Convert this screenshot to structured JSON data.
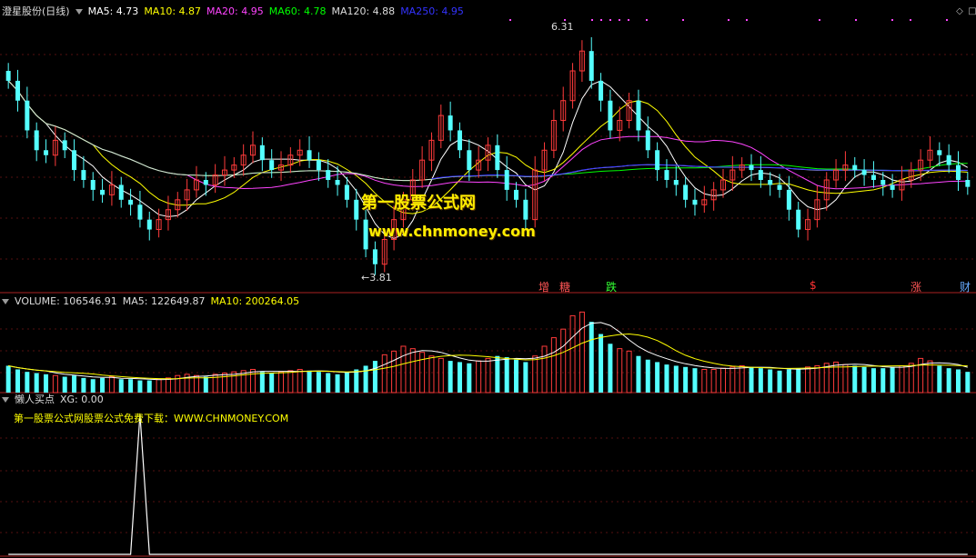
{
  "price_header": {
    "name": "澄星股份(日线)",
    "ma": [
      {
        "label": "MA5: 4.73",
        "color": "#ffffff"
      },
      {
        "label": "MA10: 4.87",
        "color": "#ffff00"
      },
      {
        "label": "MA20: 4.95",
        "color": "#ff44ff"
      },
      {
        "label": "MA60: 4.78",
        "color": "#00ff00"
      },
      {
        "label": "MA120: 4.88",
        "color": "#dddddd"
      },
      {
        "label": "MA250: 4.95",
        "color": "#3333ff"
      }
    ]
  },
  "volume_header": {
    "volume": "VOLUME: 106546.91",
    "ma5": "MA5: 122649.87",
    "ma10": "MA10: 200264.05"
  },
  "indicator_header": {
    "name": "懒人买点",
    "xg": "XG: 0.00",
    "note": "第一股票公式网股票公式免费下载：WWW.CHNMONEY.COM"
  },
  "watermark": {
    "line1": "第一股票公式网",
    "line2": "www.chnmoney.com"
  },
  "annotations": {
    "high": "6.31",
    "low": "3.81"
  },
  "events": [
    {
      "text": "增",
      "color": "#ff5555"
    },
    {
      "text": "糖",
      "color": "#ff5555"
    },
    {
      "text": "跌",
      "color": "#33ff33"
    },
    {
      "text": "$",
      "color": "#ff3333"
    },
    {
      "text": "涨",
      "color": "#ff5555"
    },
    {
      "text": "财",
      "color": "#66aaff"
    }
  ],
  "chart_data": [
    {
      "type": "candlestick",
      "ylim": [
        3.7,
        6.45
      ],
      "high": 6.31,
      "low": 3.81,
      "ma_final": {
        "MA5": 4.73,
        "MA10": 4.87,
        "MA20": 4.95,
        "MA60": 4.78,
        "MA120": 4.88,
        "MA250": 4.95
      },
      "close": [
        5.8,
        5.6,
        5.3,
        5.1,
        5.05,
        5.2,
        5.1,
        4.9,
        4.8,
        4.7,
        4.65,
        4.75,
        4.6,
        4.55,
        4.4,
        4.3,
        4.4,
        4.5,
        4.6,
        4.7,
        4.8,
        4.75,
        4.85,
        4.9,
        4.95,
        5.05,
        5.15,
        5.0,
        4.9,
        4.95,
        5.05,
        5.1,
        5.0,
        4.9,
        4.8,
        4.75,
        4.6,
        4.4,
        4.1,
        3.95,
        4.2,
        4.4,
        4.6,
        4.8,
        5.0,
        5.2,
        5.45,
        5.3,
        5.1,
        4.9,
        5.0,
        5.15,
        4.9,
        4.7,
        4.6,
        4.4,
        4.9,
        5.1,
        5.4,
        5.6,
        5.9,
        6.1,
        5.8,
        5.6,
        5.3,
        5.4,
        5.6,
        5.3,
        5.1,
        4.9,
        4.8,
        4.75,
        4.6,
        4.55,
        4.6,
        4.7,
        4.8,
        4.9,
        4.95,
        4.9,
        4.8,
        4.75,
        4.7,
        4.5,
        4.3,
        4.4,
        4.6,
        4.8,
        4.9,
        4.95,
        4.9,
        4.85,
        4.8,
        4.75,
        4.7,
        4.8,
        4.9,
        5.0,
        5.1,
        5.05,
        4.95,
        4.8,
        4.73
      ]
    },
    {
      "type": "bar",
      "name": "VOLUME",
      "last": 106546.91,
      "ma5": 122649.87,
      "ma10": 200264.05,
      "values": [
        22,
        19,
        17,
        16,
        15,
        14,
        13,
        14,
        12,
        11,
        12,
        13,
        11,
        11,
        10,
        10,
        11,
        12,
        14,
        15,
        14,
        13,
        15,
        16,
        17,
        18,
        19,
        17,
        16,
        17,
        18,
        19,
        18,
        17,
        16,
        15,
        17,
        19,
        22,
        26,
        31,
        34,
        38,
        36,
        33,
        30,
        28,
        26,
        25,
        24,
        26,
        28,
        30,
        29,
        27,
        25,
        30,
        38,
        45,
        52,
        63,
        66,
        58,
        48,
        40,
        36,
        34,
        30,
        27,
        25,
        23,
        22,
        21,
        20,
        19,
        19,
        20,
        21,
        22,
        21,
        20,
        19,
        18,
        19,
        20,
        21,
        22,
        24,
        25,
        23,
        22,
        21,
        20,
        20,
        21,
        22,
        24,
        28,
        26,
        22,
        20,
        19,
        17
      ],
      "ylim": [
        0,
        70
      ]
    },
    {
      "type": "line",
      "name": "XG",
      "last": 0.0,
      "values": [
        0,
        0,
        0,
        0,
        0,
        0,
        0,
        0,
        0,
        0,
        0,
        0,
        0,
        0,
        1,
        0,
        0,
        0,
        0,
        0,
        0,
        0,
        0,
        0,
        0,
        0,
        0,
        0,
        0,
        0,
        0,
        0,
        0,
        0,
        0,
        0,
        0,
        0,
        0,
        0,
        0,
        0,
        0,
        0,
        0,
        0,
        0,
        0,
        0,
        0,
        0,
        0,
        0,
        0,
        0,
        0,
        0,
        0,
        0,
        0,
        0,
        0,
        0,
        0,
        0,
        0,
        0,
        0,
        0,
        0,
        0,
        0,
        0,
        0,
        0,
        0,
        0,
        0,
        0,
        0,
        0,
        0,
        0,
        0,
        0,
        0,
        0,
        0,
        0,
        0,
        0,
        0,
        0,
        0,
        0,
        0,
        0,
        0,
        0,
        0,
        0,
        0,
        0
      ],
      "ylim": [
        0,
        1
      ]
    }
  ]
}
